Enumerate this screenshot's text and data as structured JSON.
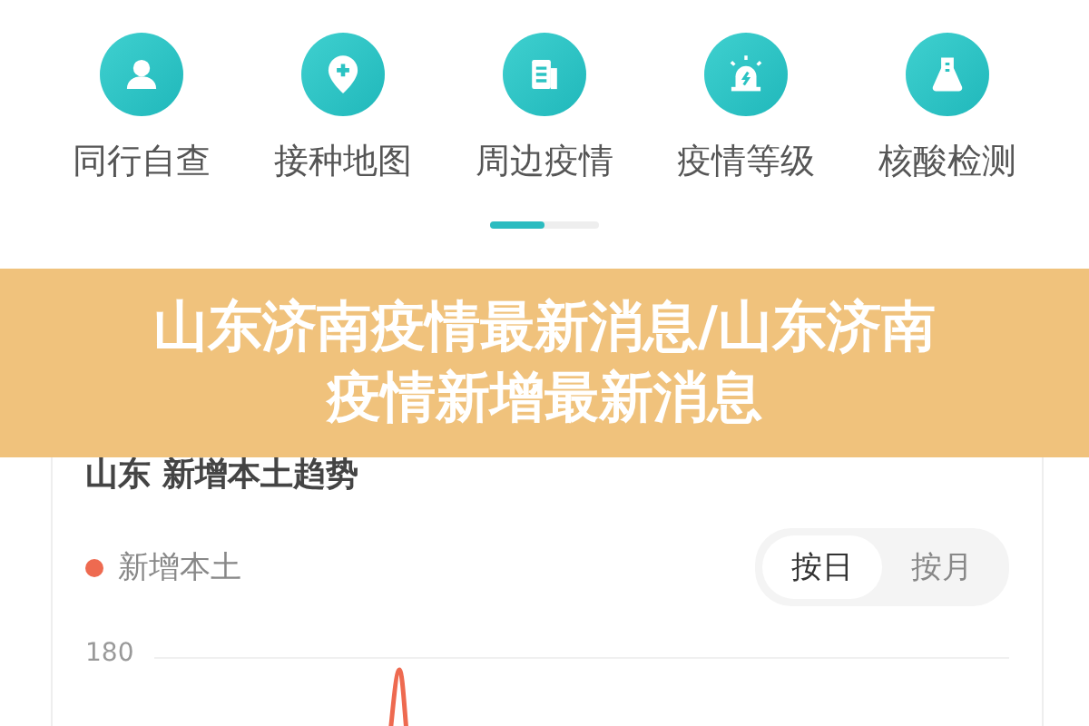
{
  "shortcuts": [
    {
      "label": "同行自查"
    },
    {
      "label": "接种地图"
    },
    {
      "label": "周边疫情"
    },
    {
      "label": "疫情等级"
    },
    {
      "label": "核酸检测"
    }
  ],
  "pager": {
    "level": 0.5
  },
  "trend_card": {
    "title": "山东 新增本土趋势",
    "legend": {
      "label": "新增本土",
      "color": "#ee6a50"
    },
    "period_tabs": [
      {
        "label": "按日",
        "selected": true
      },
      {
        "label": "按月",
        "selected": false
      }
    ],
    "axis_label": "180"
  },
  "title_banner": {
    "lines": [
      "山东济南疫情最新消息/山东济南",
      "疫情新增最新消息"
    ]
  }
}
